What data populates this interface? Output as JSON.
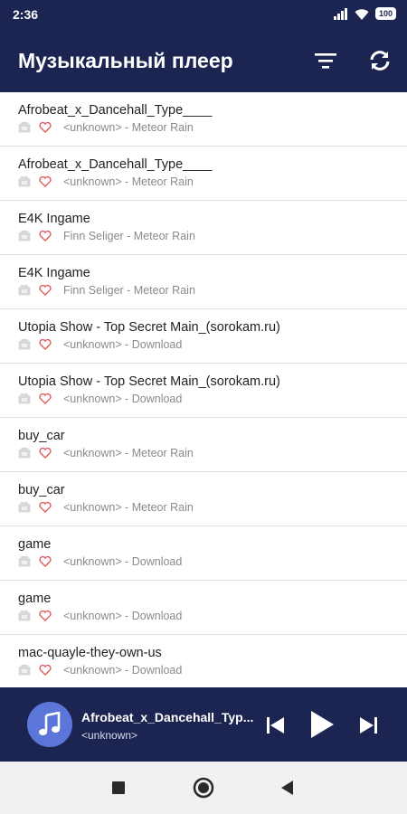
{
  "status_bar": {
    "time": "2:36",
    "battery": "100",
    "icons": [
      "signal-icon",
      "wifi-icon",
      "battery-icon"
    ]
  },
  "app_bar": {
    "title": "Музыкальный плеер",
    "actions": [
      "sort-icon",
      "refresh-icon"
    ],
    "color": "#1c2452"
  },
  "songs": [
    {
      "title": "Afrobeat_x_Dancehall_Type____",
      "artist": "<unknown> - Meteor Rain"
    },
    {
      "title": "Afrobeat_x_Dancehall_Type____",
      "artist": "<unknown> - Meteor Rain"
    },
    {
      "title": "E4K Ingame",
      "artist": "Finn Seliger - Meteor Rain"
    },
    {
      "title": "E4K Ingame",
      "artist": "Finn Seliger - Meteor Rain"
    },
    {
      "title": "Utopia Show - Top Secret Main_(sorokam.ru)",
      "artist": "<unknown> - Download"
    },
    {
      "title": "Utopia Show - Top Secret Main_(sorokam.ru)",
      "artist": "<unknown> - Download"
    },
    {
      "title": "buy_car",
      "artist": "<unknown> - Meteor Rain"
    },
    {
      "title": "buy_car",
      "artist": "<unknown> - Meteor Rain"
    },
    {
      "title": "game",
      "artist": "<unknown> - Download"
    },
    {
      "title": "game",
      "artist": "<unknown> - Download"
    },
    {
      "title": "mac-quayle-they-own-us",
      "artist": "<unknown> - Download"
    }
  ],
  "now_playing": {
    "title": "Afrobeat_x_Dancehall_Typ...",
    "artist": "<unknown>",
    "cover_icon": "music-note-icon",
    "controls": [
      "previous-icon",
      "play-icon",
      "next-icon"
    ]
  },
  "nav_bar": {
    "buttons": [
      "recents-icon",
      "home-icon",
      "back-icon"
    ]
  },
  "colors": {
    "primary": "#1c2452",
    "cover": "#5b76d8",
    "heart": "#e05a5a",
    "secondary_text": "#8a8a8a"
  }
}
